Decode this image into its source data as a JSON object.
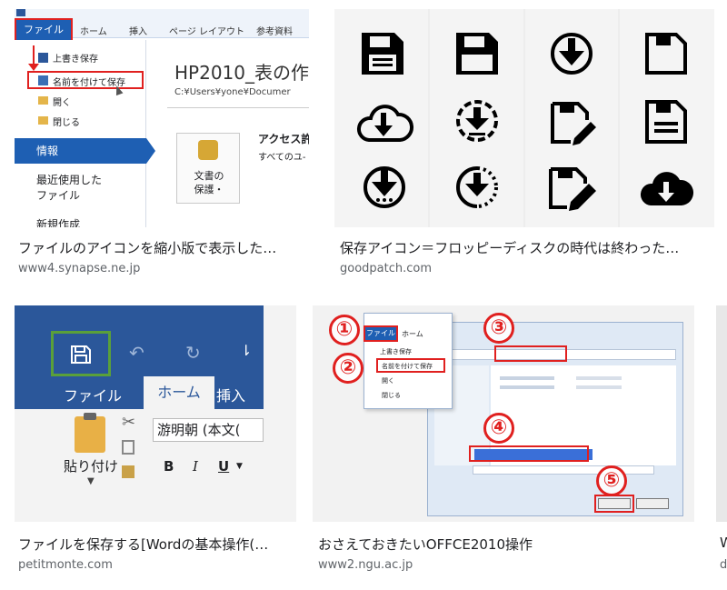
{
  "results": [
    {
      "title": "ファイルのアイコンを縮小版で表示した…",
      "domain": "www4.synapse.ne.jp",
      "thumb": {
        "tabs": [
          "ファイル",
          "ホーム",
          "挿入",
          "ページ レイアウト",
          "参考資料"
        ],
        "menu_items": [
          "上書き保存",
          "名前を付けて保存",
          "開く",
          "閉じる"
        ],
        "side_items": [
          "情報",
          "最近使用した\nファイル",
          "新規作成"
        ],
        "doc_title": "HP2010_表の作",
        "doc_path": "C:¥Users¥yone¥Documer",
        "protect_label": "文書の\n保護・",
        "access_label": "アクセス許",
        "access_sub": "すべてのユ-"
      }
    },
    {
      "title": "保存アイコン＝フロッピーディスクの時代は終わった…",
      "domain": "goodpatch.com",
      "thumb": {
        "icons": [
          "floppy-icon",
          "floppy-outline-icon",
          "download-circle-icon",
          "floppy-plain-icon",
          "cloud-download-icon",
          "download-dashed-icon",
          "floppy-edit-icon",
          "floppy-lines-icon",
          "download-circle-dots-icon",
          "download-progress-icon",
          "floppy-pencil-icon",
          "cloud-download-outline-icon"
        ]
      }
    },
    {
      "title": "ファイルを保存する[Wordの基本操作(…",
      "domain": "petitmonte.com",
      "thumb": {
        "tabs": [
          "ファイル",
          "ホーム",
          "挿入"
        ],
        "paste_label": "貼り付け",
        "font_name": "游明朝 (本文(",
        "format_buttons": [
          "B",
          "I",
          "U"
        ]
      }
    },
    {
      "title": "おさえておきたいOFFCE2010操作",
      "domain": "www2.ngu.ac.jp",
      "thumb": {
        "steps": [
          "①",
          "②",
          "③",
          "④",
          "⑤"
        ],
        "menu_items": [
          "ファイル",
          "ホーム",
          "上書き保存",
          "名前を付けて保存",
          "開く",
          "閉じる"
        ]
      }
    },
    {
      "title": "W",
      "domain": "d"
    }
  ],
  "colors": {
    "word_blue": "#2b579a",
    "office_blue": "#1e5fb3",
    "highlight_red": "#e0201f",
    "save_green": "#5aa03a"
  }
}
